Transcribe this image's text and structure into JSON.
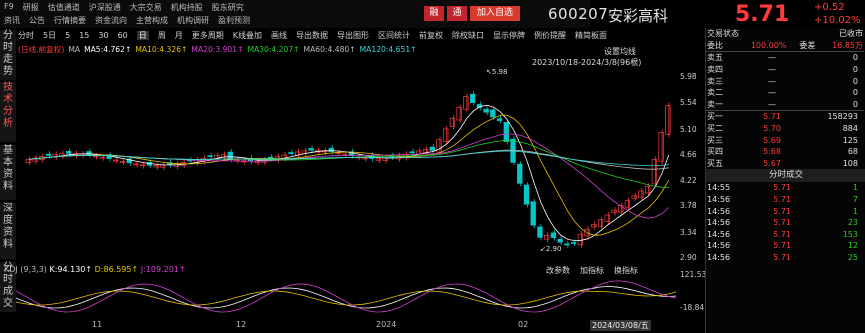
{
  "topnav": {
    "row1": [
      "F9",
      "研报",
      "估值通道",
      "沪深股通",
      "大宗交易",
      "机构持股",
      "股东研究"
    ],
    "row2": [
      "资讯",
      "公告",
      "行情摘要",
      "资金流向",
      "主营构成",
      "机构调研",
      "盈利预测"
    ],
    "rong_label": "融",
    "tong_label": "通",
    "add_watch_label": "加入自选",
    "stock_code": "600207",
    "stock_name": "安彩高科",
    "price": "5.71",
    "change": "+0.52",
    "change_pct": "+10.02%"
  },
  "side_tabs": [
    {
      "label": "分时走势",
      "active": false
    },
    {
      "label": "技术分析",
      "active": true
    },
    {
      "label": "基本资料",
      "active": false
    },
    {
      "label": "深度资料",
      "active": false
    },
    {
      "label": "分时成交",
      "active": false
    }
  ],
  "toolbar": {
    "items": [
      "分时",
      "5日",
      "5",
      "15",
      "30",
      "60",
      "日",
      "周",
      "月",
      "更多周期",
      "K线叠加",
      "画线",
      "导出数据",
      "导出图形",
      "区间统计",
      "前复权",
      "除权缺口",
      "显示停牌",
      "例价提醒",
      "精简板面"
    ],
    "selected": "日"
  },
  "legend": [
    {
      "text": "(日线,前复权)",
      "color": "#ff3b3b"
    },
    {
      "text": "MA",
      "color": "#bbbbbb"
    },
    {
      "text": "MA5:4.762↑",
      "color": "#ffffff"
    },
    {
      "text": "MA10:4.326↑",
      "color": "#e6c300"
    },
    {
      "text": "MA20:3.901↑",
      "color": "#d040d0"
    },
    {
      "text": "MA30:4.207↑",
      "color": "#20d020"
    },
    {
      "text": "MA60:4.480↑",
      "color": "#bbbbbb"
    },
    {
      "text": "MA120:4.651↑",
      "color": "#3ad6d6"
    }
  ],
  "chart_overlay": {
    "settings_label": "设置均线",
    "range_label": "2023/10/18-2024/3/8(96根)",
    "high_label": "5.98",
    "low_label": "2.90"
  },
  "y_axis_main": [
    "5.98",
    "5.54",
    "5.10",
    "4.66",
    "4.22",
    "3.78",
    "3.34",
    "2.90"
  ],
  "kdj": {
    "title": "KDJ (9,3,3)",
    "k": "K:94.130↑",
    "d": "D:86.595↑",
    "j": "J:109.201↑",
    "buttons": [
      "改参数",
      "加指标",
      "换指标"
    ],
    "y_top": "121.53",
    "y_bottom": "-18.84"
  },
  "x_labels": [
    "11",
    "12",
    "2024",
    "02",
    "2024/03/08/五"
  ],
  "right_panel": {
    "status_label": "交易状态",
    "status_value": "已收市",
    "weibi_label": "委比",
    "weibi_value": "100.00%",
    "weicha_label": "委差",
    "weicha_value": "16.85万",
    "asks": [
      {
        "label": "卖五",
        "price": "—",
        "vol": "0"
      },
      {
        "label": "卖四",
        "price": "—",
        "vol": "0"
      },
      {
        "label": "卖三",
        "price": "—",
        "vol": "0"
      },
      {
        "label": "卖二",
        "price": "—",
        "vol": "0"
      },
      {
        "label": "卖一",
        "price": "—",
        "vol": "0"
      }
    ],
    "bids": [
      {
        "label": "买一",
        "price": "5.71",
        "vol": "158293"
      },
      {
        "label": "买二",
        "price": "5.70",
        "vol": "884"
      },
      {
        "label": "买三",
        "price": "5.69",
        "vol": "125"
      },
      {
        "label": "买四",
        "price": "5.68",
        "vol": "68"
      },
      {
        "label": "买五",
        "price": "5.67",
        "vol": "108"
      }
    ],
    "trades_title": "分时成交",
    "trades": [
      {
        "time": "14:55",
        "price": "5.71",
        "vol": "1"
      },
      {
        "time": "14:56",
        "price": "5.71",
        "vol": "7"
      },
      {
        "time": "14:56",
        "price": "5.71",
        "vol": "1"
      },
      {
        "time": "14:56",
        "price": "5.71",
        "vol": "23"
      },
      {
        "time": "14:56",
        "price": "5.71",
        "vol": "153"
      },
      {
        "time": "14:56",
        "price": "5.71",
        "vol": "12"
      },
      {
        "time": "14:56",
        "price": "5.71",
        "vol": "25"
      }
    ]
  },
  "colors": {
    "up": "#ff3b3b",
    "down": "#00c8c8",
    "ma5": "#ffffff",
    "ma10": "#e6c300",
    "ma20": "#d040d0",
    "ma30": "#20d020",
    "ma60": "#bbbbbb",
    "ma120": "#3ad6d6"
  }
}
